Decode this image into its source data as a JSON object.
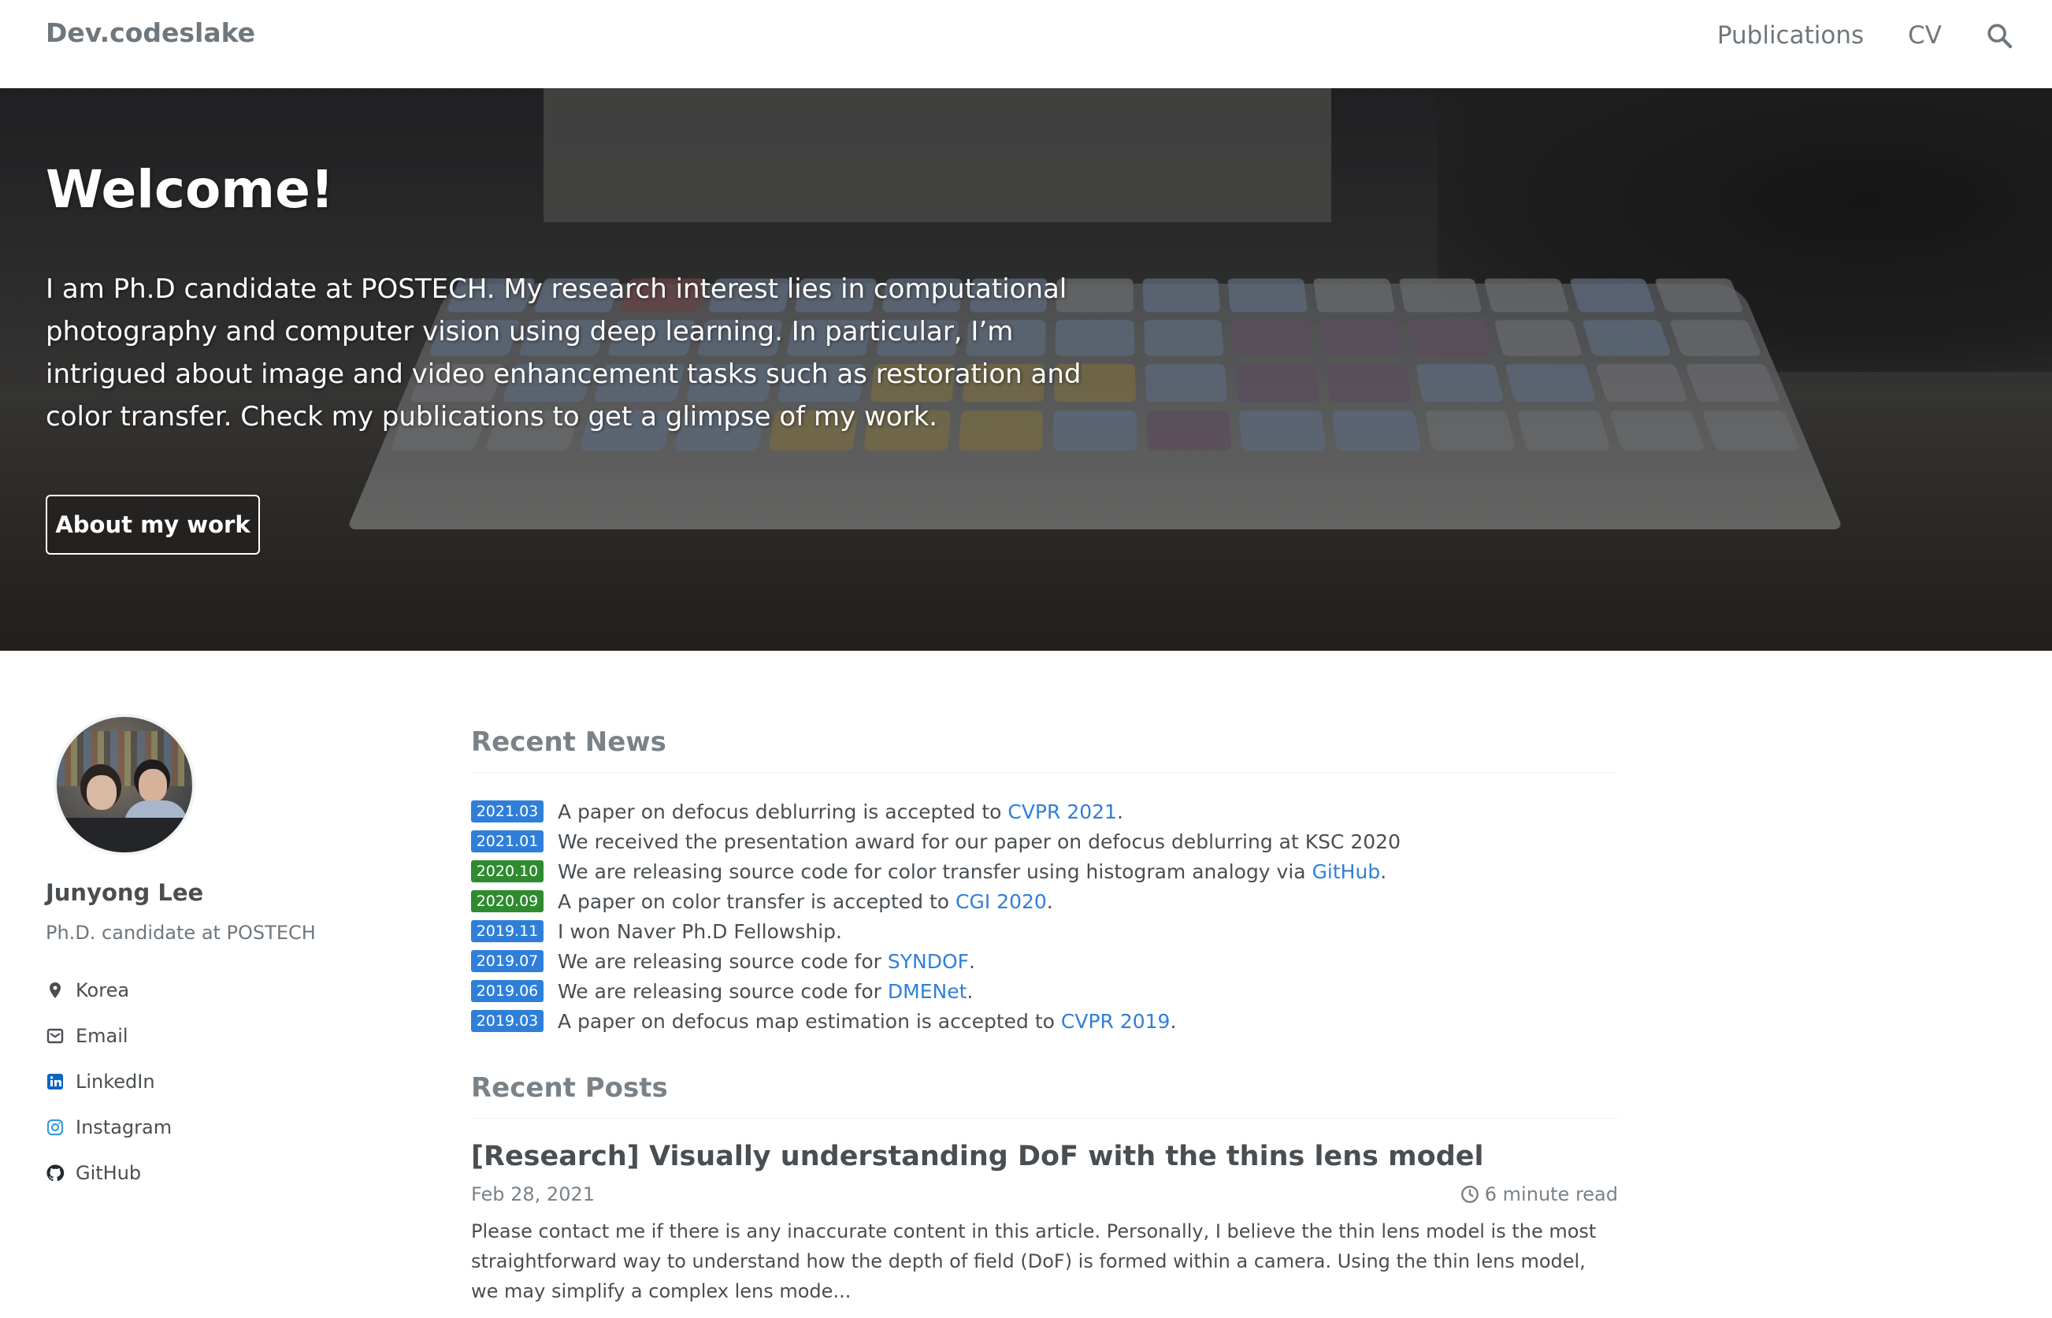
{
  "nav": {
    "brand": "Dev.codeslake",
    "links": [
      "Publications",
      "CV"
    ],
    "search_icon": "search-icon"
  },
  "hero": {
    "title": "Welcome!",
    "text": "I am Ph.D candidate at POSTECH. My research interest lies in computational photography and computer vision using deep learning. In particular, I’m intrigued about image and video enhancement tasks such as restoration and color transfer. Check my publications to get a glimpse of my work.",
    "button": "About my work"
  },
  "profile": {
    "name": "Junyong Lee",
    "bio": "Ph.D. candidate at POSTECH",
    "links": [
      {
        "label": "Korea",
        "icon": "location-icon"
      },
      {
        "label": "Email",
        "icon": "email-icon"
      },
      {
        "label": "LinkedIn",
        "icon": "linkedin-icon"
      },
      {
        "label": "Instagram",
        "icon": "instagram-icon"
      },
      {
        "label": "GitHub",
        "icon": "github-icon"
      }
    ]
  },
  "news": {
    "heading": "Recent News",
    "items": [
      {
        "date": "2021.03",
        "color": "#2f7fd9",
        "text": "A paper on defocus deblurring is accepted to ",
        "link": "CVPR 2021",
        "after": "."
      },
      {
        "date": "2021.01",
        "color": "#2f7fd9",
        "text": "We received the presentation award for our paper on defocus deblurring at KSC 2020",
        "link": "",
        "after": ""
      },
      {
        "date": "2020.10",
        "color": "#2e8b2e",
        "text": "We are releasing source code for color transfer using histogram analogy via ",
        "link": "GitHub",
        "after": "."
      },
      {
        "date": "2020.09",
        "color": "#2e8b2e",
        "text": "A paper on color transfer is accepted to ",
        "link": "CGI 2020",
        "after": "."
      },
      {
        "date": "2019.11",
        "color": "#2f7fd9",
        "text": "I won Naver Ph.D Fellowship.",
        "link": "",
        "after": ""
      },
      {
        "date": "2019.07",
        "color": "#2f7fd9",
        "text": "We are releasing source code for ",
        "link": "SYNDOF",
        "after": "."
      },
      {
        "date": "2019.06",
        "color": "#2f7fd9",
        "text": "We are releasing source code for ",
        "link": "DMENet",
        "after": "."
      },
      {
        "date": "2019.03",
        "color": "#2f7fd9",
        "text": "A paper on defocus map estimation is accepted to ",
        "link": "CVPR 2019",
        "after": "."
      }
    ]
  },
  "posts": {
    "heading": "Recent Posts",
    "items": [
      {
        "title": "[Research] Visually understanding DoF with the thins lens model",
        "date": "Feb 28, 2021",
        "read_time": "6 minute read",
        "excerpt": "Please contact me if there is any inaccurate content in this article. Personally, I believe the thin lens model is the most straightforward way to understand how the depth of field (DoF) is formed within a camera. Using the thin lens model, we may simplify a complex lens mode..."
      }
    ]
  }
}
